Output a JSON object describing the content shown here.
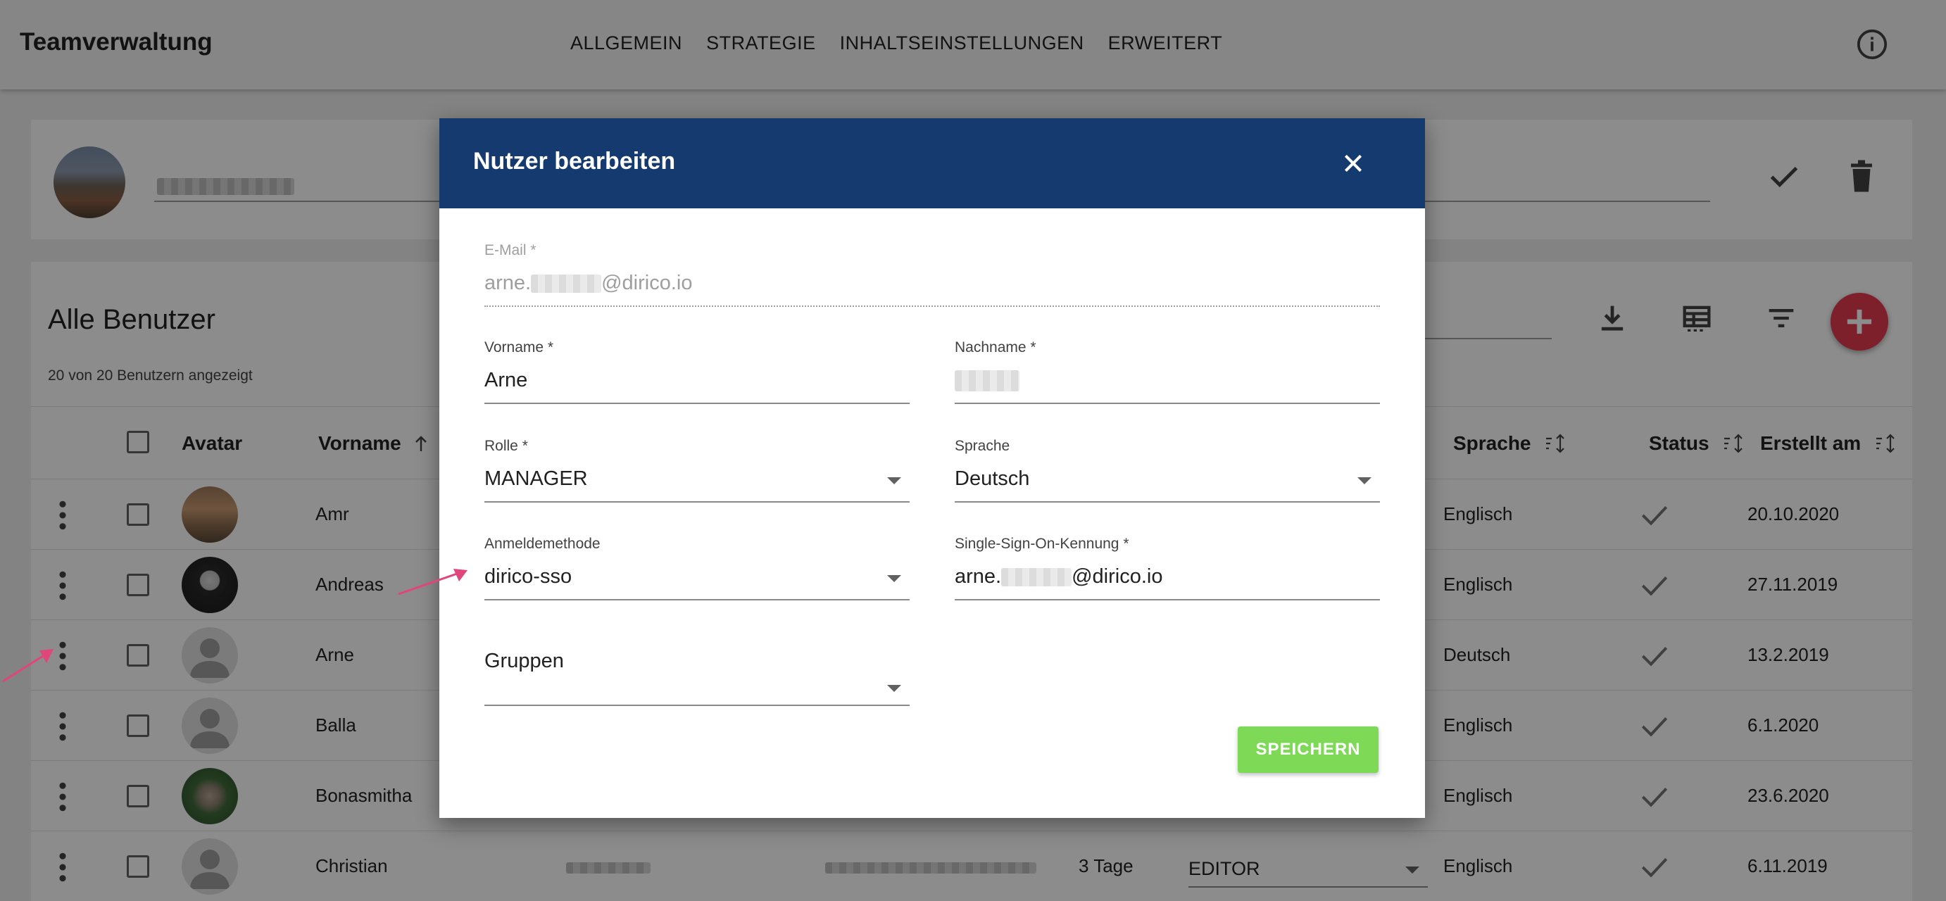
{
  "app": {
    "title": "Teamverwaltung"
  },
  "nav": {
    "tabs": [
      "ALLGEMEIN",
      "STRATEGIE",
      "INHALTSEINSTELLUNGEN",
      "ERWEITERT"
    ]
  },
  "icons": {
    "info": "info-icon",
    "check": "check-icon",
    "delete": "trash-icon",
    "download": "download-icon",
    "table": "table-icon",
    "filter": "filter-icon",
    "add": "plus-icon",
    "more": "more-vert-icon",
    "close": "close-icon"
  },
  "users": {
    "title": "Alle Benutzer",
    "count_label": "20 von 20 Benutzern angezeigt",
    "columns": {
      "avatar": "Avatar",
      "first_name": "Vorname",
      "language": "Sprache",
      "status": "Status",
      "created": "Erstellt am"
    },
    "rows": [
      {
        "first_name": "Amr",
        "language": "Englisch",
        "created": "20.10.2020"
      },
      {
        "first_name": "Andreas",
        "language": "Englisch",
        "created": "27.11.2019"
      },
      {
        "first_name": "Arne",
        "language": "Deutsch",
        "created": "13.2.2019"
      },
      {
        "first_name": "Balla",
        "language": "Englisch",
        "created": "6.1.2020"
      },
      {
        "first_name": "Bonasmitha",
        "language": "Englisch",
        "created": "23.6.2020"
      },
      {
        "first_name": "Christian",
        "language": "Englisch",
        "created": "6.11.2019",
        "days": "3 Tage",
        "role": "EDITOR"
      }
    ]
  },
  "dialog": {
    "title": "Nutzer bearbeiten",
    "email": {
      "label": "E-Mail *",
      "prefix": "arne.",
      "suffix": "@dirico.io"
    },
    "first_name": {
      "label": "Vorname *",
      "value": "Arne"
    },
    "last_name": {
      "label": "Nachname *"
    },
    "role": {
      "label": "Rolle *",
      "value": "MANAGER"
    },
    "language": {
      "label": "Sprache",
      "value": "Deutsch"
    },
    "login_method": {
      "label": "Anmeldemethode",
      "value": "dirico-sso"
    },
    "sso_id": {
      "label": "Single-Sign-On-Kennung *",
      "prefix": "arne.",
      "suffix": "@dirico.io"
    },
    "groups": {
      "label": "Gruppen"
    },
    "save_label": "SPEICHERN"
  },
  "colors": {
    "header": "#153a70",
    "save": "#7ed957",
    "fab": "#e53951",
    "arrow": "#e0457b"
  }
}
